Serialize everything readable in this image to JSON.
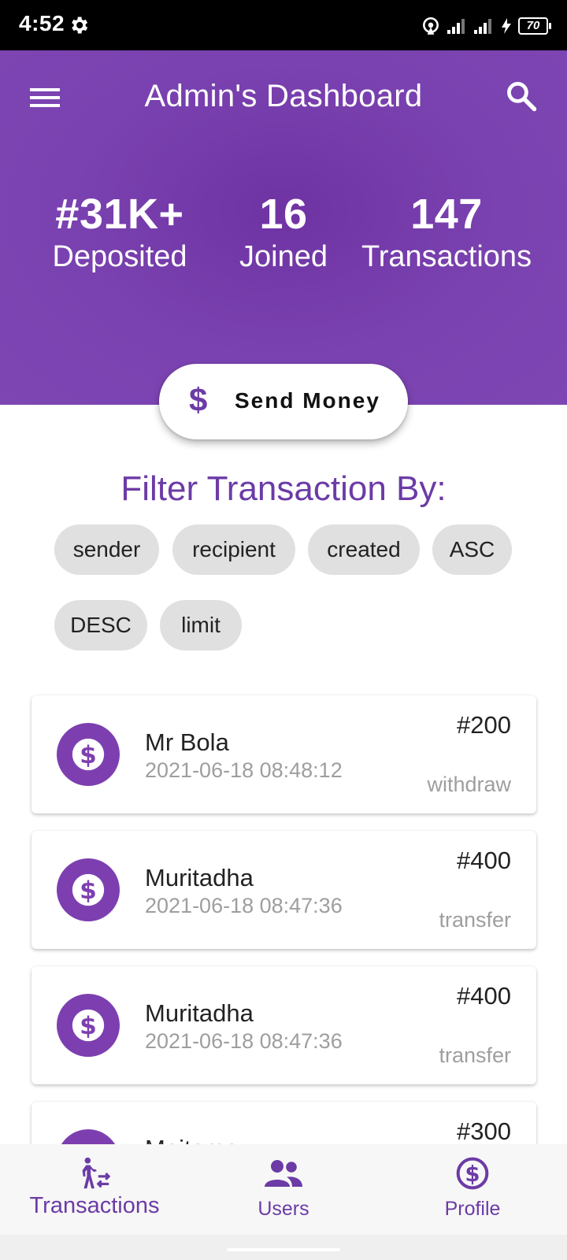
{
  "status_bar": {
    "time": "4:52",
    "battery": "70"
  },
  "header": {
    "title": "Admin's Dashboard"
  },
  "stats": [
    {
      "value": "#31K+",
      "label": "Deposited"
    },
    {
      "value": "16",
      "label": "Joined"
    },
    {
      "value": "147",
      "label": "Transactions"
    }
  ],
  "send_money": {
    "icon": "$",
    "label": "Send Money"
  },
  "filter": {
    "title": "Filter Transaction By:",
    "chips": [
      "sender",
      "recipient",
      "created",
      "ASC",
      "DESC",
      "limit"
    ]
  },
  "transactions": [
    {
      "name": "Mr Bola",
      "date": "2021-06-18 08:48:12",
      "amount": "#200",
      "type": "withdraw"
    },
    {
      "name": "Muritadha",
      "date": "2021-06-18 08:47:36",
      "amount": "#400",
      "type": "transfer"
    },
    {
      "name": "Muritadha",
      "date": "2021-06-18 08:47:36",
      "amount": "#400",
      "type": "transfer"
    },
    {
      "name": "Moitomo",
      "date": "",
      "amount": "#300",
      "type": ""
    }
  ],
  "bottom_nav": [
    {
      "label": "Transactions",
      "icon": "transactions-icon",
      "active": true
    },
    {
      "label": "Users",
      "icon": "users-icon",
      "active": false
    },
    {
      "label": "Profile",
      "icon": "dollar-circle-icon",
      "active": false
    }
  ],
  "colors": {
    "primary": "#7b41b0",
    "accent_text": "#6c3ba6",
    "chip_bg": "#e0e0e0"
  }
}
